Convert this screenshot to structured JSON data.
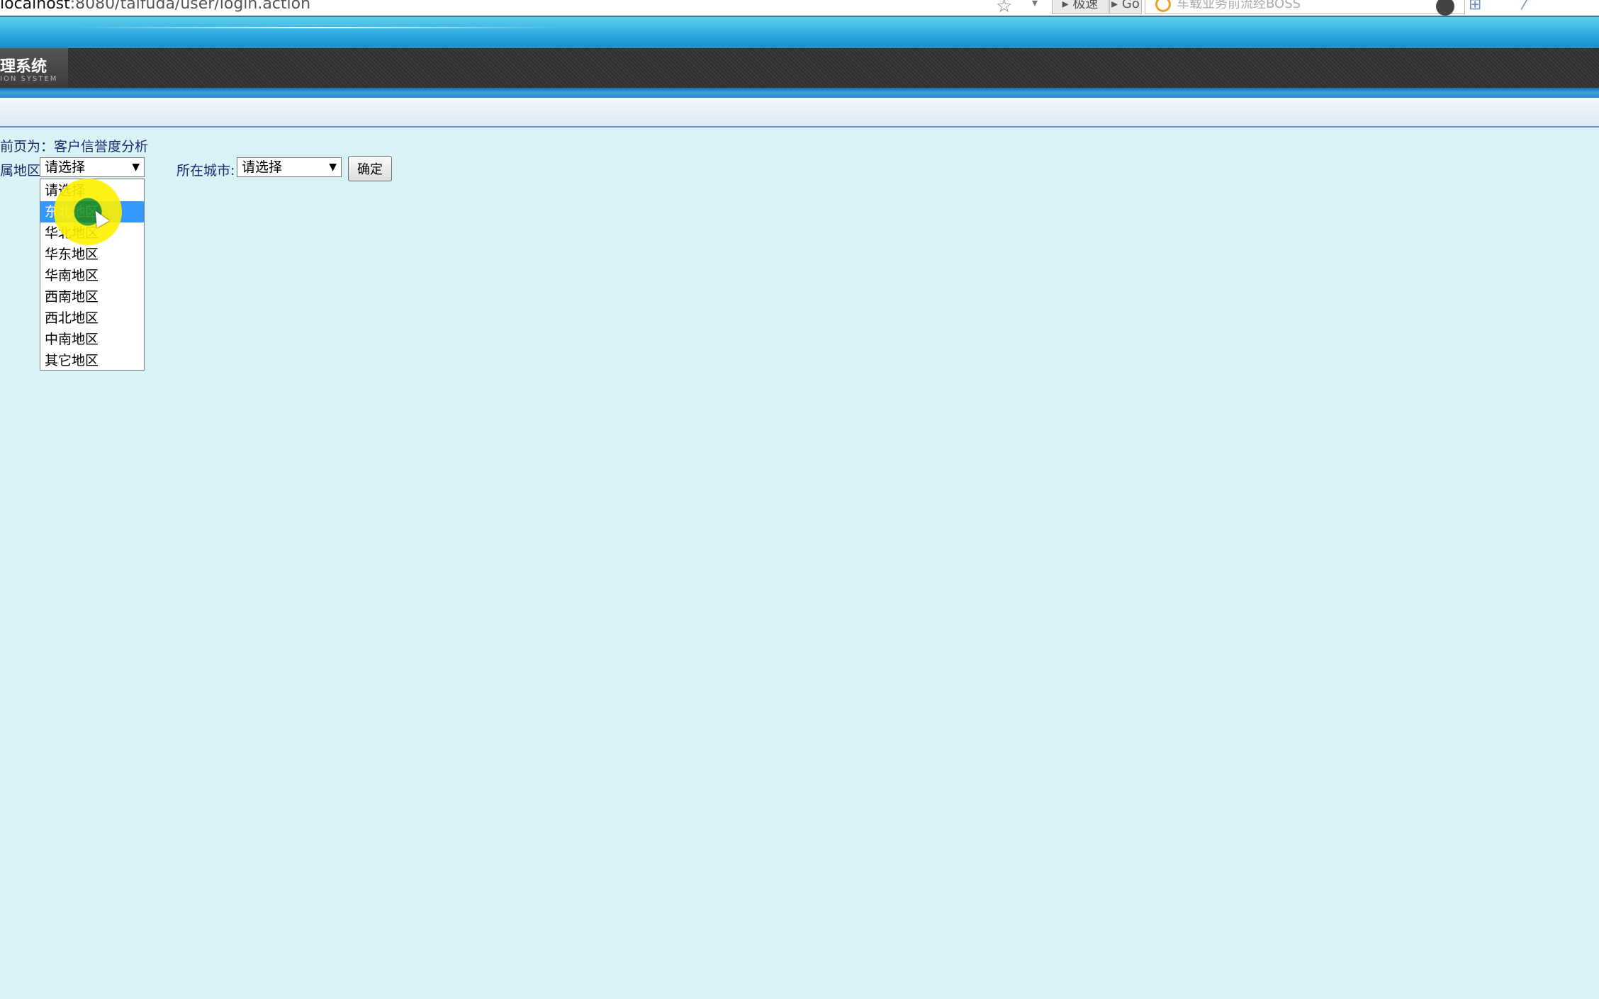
{
  "browser": {
    "url_host": "localhost",
    "url_rest": ":8080/taifuda/user/login.action",
    "speed_label": "▸ 极速",
    "go_label": "▸ Go",
    "search_placeholder": "车载业务前流经BOSS"
  },
  "header": {
    "system_title": "理系统",
    "system_subtitle": "ION SYSTEM"
  },
  "content": {
    "breadcrumb": "前页为：客户信誉度分析",
    "region_label": "属地区:",
    "region_selected": "请选择",
    "city_label": "所在城市:",
    "city_selected": "请选择",
    "confirm_label": "确定",
    "region_options": [
      "请选择",
      "东北地区",
      "华北地区",
      "华东地区",
      "华南地区",
      "西南地区",
      "西北地区",
      "中南地区",
      "其它地区"
    ],
    "highlighted_option_index": 1
  },
  "icons": {
    "star": "☆",
    "dropdown": "▾",
    "select_arrow": "▼",
    "tools": "⊞ ⁄ ♻ ◐"
  },
  "colors": {
    "page_background": "#d8f2f6",
    "selected_option": "#3399ff",
    "label_text": "#1a2a6c"
  }
}
